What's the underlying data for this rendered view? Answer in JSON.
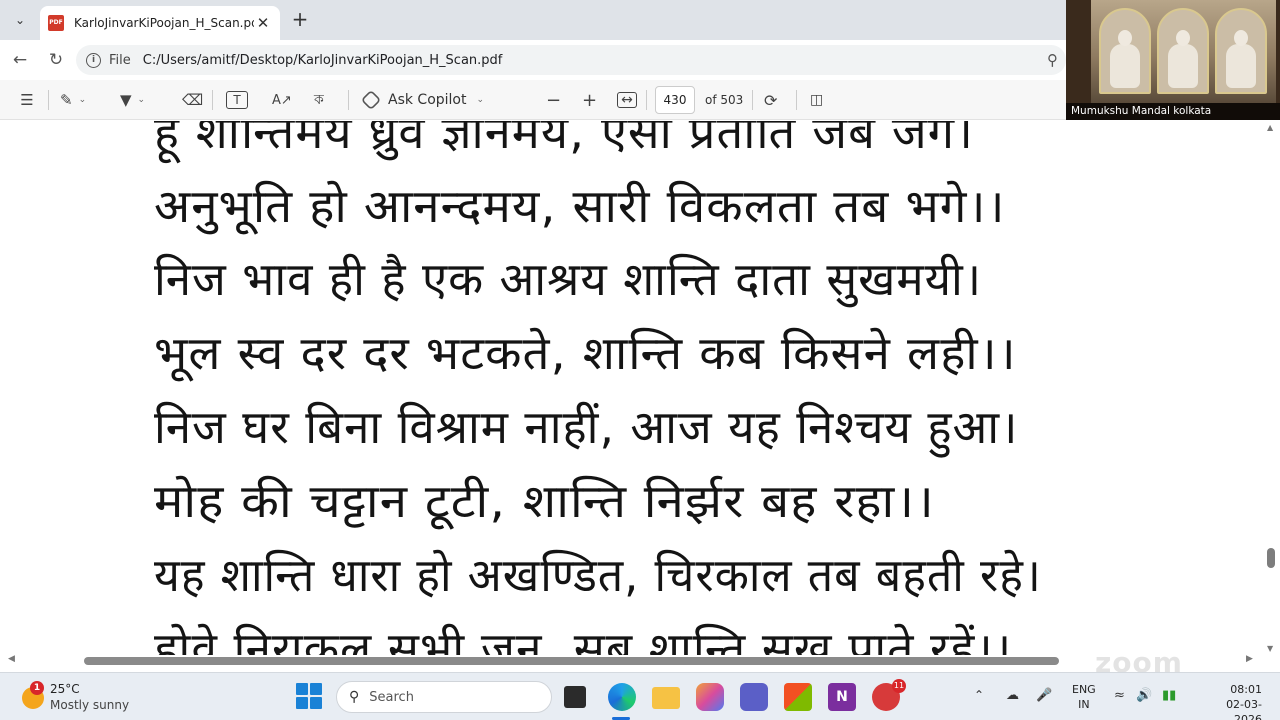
{
  "browser": {
    "tab": {
      "title": "KarloJinvarKiPoojan_H_Scan.pdf"
    },
    "address": {
      "scheme_label": "File",
      "url": "C:/Users/amitf/Desktop/KarloJinvarKiPoojan_H_Scan.pdf"
    }
  },
  "pdf_toolbar": {
    "copilot_label": "Ask Copilot",
    "current_page": "430",
    "page_count_label": "of 503"
  },
  "video": {
    "participant_name": "Mumukshu Mandal kolkata"
  },
  "document": {
    "lines": [
      "हूँ शान्तिमय ध्रुव ज्ञानमय, ऐसी प्रतीति जब जगे।",
      "अनुभूति हो आनन्दमय, सारी विकलता तब भगे।।",
      "निज भाव ही है एक आश्रय शान्ति दाता सुखमयी।",
      "भूल स्व दर दर भटकते, शान्ति कब किसने लही।।",
      "निज घर बिना विश्राम नाहीं, आज यह निश्चय हुआ।",
      "मोह की चट्टान टूटी, शान्ति निर्झर बह रहा।।",
      "यह शान्ति धारा हो अखण्डित, चिरकाल तब बहती रहे।",
      "होवे निराकुल सभी जन, सब शान्ति सुख पाते रहें।।"
    ],
    "watermark": "zoom"
  },
  "taskbar": {
    "weather": {
      "temp": "25°C",
      "desc": "Mostly sunny",
      "badge": "1"
    },
    "search_label": "Search",
    "zoom_badge": "11",
    "language": {
      "line1": "ENG",
      "line2": "IN"
    },
    "clock": {
      "time": "08:01",
      "date": "02-03-2026"
    }
  },
  "colors": {
    "accent": "#1a6ed8",
    "pdf_icon": "#d23a2a",
    "badge": "#d8262a"
  }
}
